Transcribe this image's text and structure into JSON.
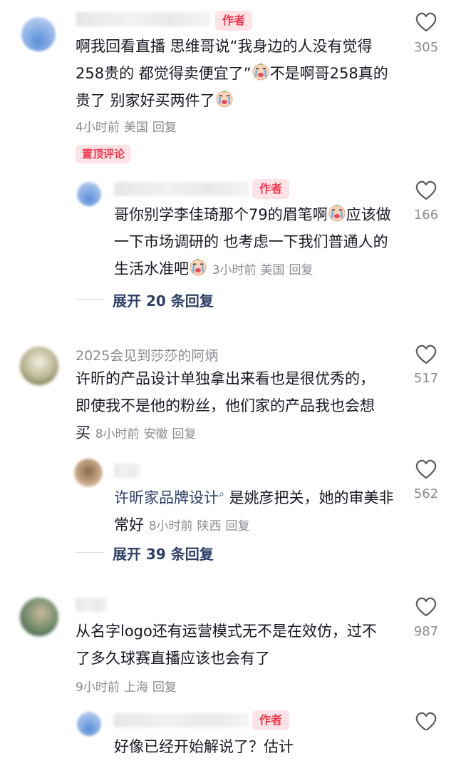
{
  "author_badge": "作者",
  "pinned_badge": "置顶评论",
  "comments": [
    {
      "text_parts": [
        "啊我回看直播 思维哥说“我身边的人没有觉得258贵的 都觉得卖便宜了”",
        "不是啊哥258真的贵了 别家好买两件了"
      ],
      "time": "4小时前",
      "location": "美国",
      "reply": "回复",
      "likes": "305"
    },
    {
      "text_parts": [
        "哥你别学李佳琦那个79的眉笔啊",
        "应该做一下市场调研的 也考虑一下我们普通人的生活水准吧"
      ],
      "time": "3小时前",
      "location": "美国",
      "reply": "回复",
      "likes": "166",
      "expand": "展开 20 条回复"
    },
    {
      "username": "2025会见到莎莎的阿炳",
      "text": "许昕的产品设计单独拿出来看也是很优秀的，即使我不是他的粉丝，他们家的产品我也会想买",
      "time": "8小时前",
      "location": "安徽",
      "reply": "回复",
      "likes": "517"
    },
    {
      "link_text": "许昕家品牌设计",
      "text": "是姚彦把关，她的审美非常好",
      "time": "8小时前",
      "location": "陕西",
      "reply": "回复",
      "likes": "562",
      "expand": "展开 39 条回复"
    },
    {
      "text": "从名字logo还有运营模式无不是在效仿，过不了多久球赛直播应该也会有了",
      "time": "9小时前",
      "location": "上海",
      "reply": "回复",
      "likes": "987"
    },
    {
      "text": "好像已经开始解说了？估计"
    }
  ],
  "colors": {
    "accent": "#f0364d",
    "badge_bg": "#fde3e6",
    "link": "#2d3e68",
    "meta": "#8a8b91"
  }
}
